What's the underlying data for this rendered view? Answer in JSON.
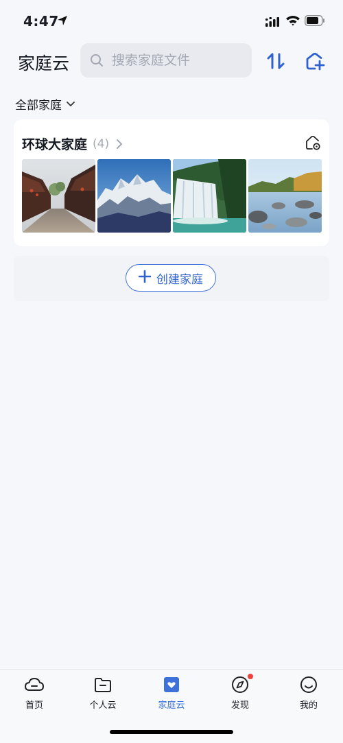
{
  "status_bar": {
    "time": "4:47"
  },
  "header": {
    "title": "家庭云",
    "search": {
      "placeholder": "搜索家庭文件",
      "value": ""
    }
  },
  "filter": {
    "label": "全部家庭"
  },
  "family_card": {
    "name": "环球大家庭",
    "count": "(4)",
    "photos": [
      {
        "subject": "old-town-street"
      },
      {
        "subject": "snow-mountain"
      },
      {
        "subject": "waterfall"
      },
      {
        "subject": "lake-rocks"
      }
    ]
  },
  "create_button": {
    "label": "创建家庭"
  },
  "tab_bar": {
    "tabs": [
      {
        "label": "首页",
        "icon": "cloud-home-icon"
      },
      {
        "label": "个人云",
        "icon": "folder-icon"
      },
      {
        "label": "家庭云",
        "icon": "heart-box-icon"
      },
      {
        "label": "发现",
        "icon": "compass-icon"
      },
      {
        "label": "我的",
        "icon": "smiley-icon"
      }
    ],
    "active_index": 2
  },
  "colors": {
    "accent": "#3f72d9",
    "background": "#f6f7fa",
    "notification_dot": "#f0413d"
  }
}
